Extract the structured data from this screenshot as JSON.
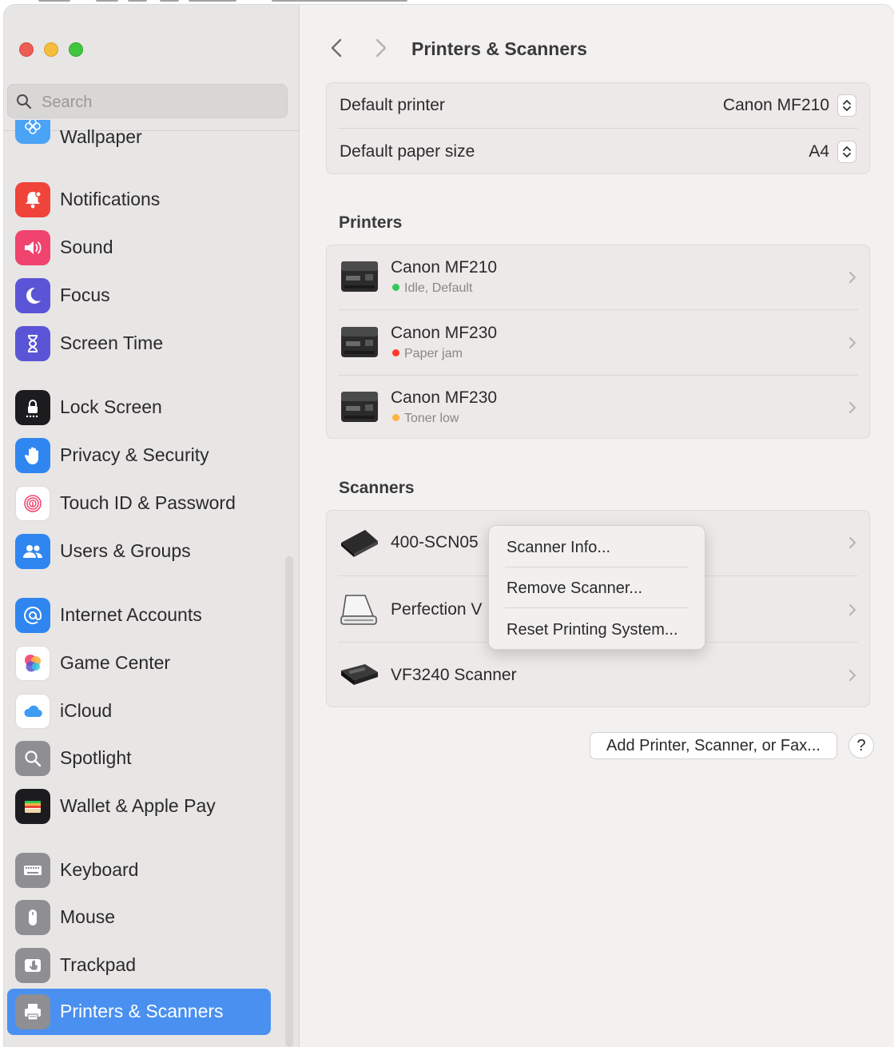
{
  "window": {
    "traffic_lights": [
      "close",
      "minimize",
      "zoom"
    ]
  },
  "sidebar": {
    "search_placeholder": "Search",
    "selected": "Printers & Scanners",
    "items": [
      {
        "label": "Wallpaper",
        "icon": "wallpaper-icon",
        "color": "#4aa3f5"
      },
      {
        "label": "Notifications",
        "icon": "bell-icon",
        "color": "#f0443a"
      },
      {
        "label": "Sound",
        "icon": "speaker-icon",
        "color": "#f0436e"
      },
      {
        "label": "Focus",
        "icon": "moon-icon",
        "color": "#5a55d6"
      },
      {
        "label": "Screen Time",
        "icon": "hourglass-icon",
        "color": "#5a55d6"
      },
      {
        "label": "Lock Screen",
        "icon": "lock-icon",
        "color": "#1c1c1e"
      },
      {
        "label": "Privacy & Security",
        "icon": "hand-icon",
        "color": "#2f86f0"
      },
      {
        "label": "Touch ID & Password",
        "icon": "fingerprint-icon",
        "color": "#ffffff"
      },
      {
        "label": "Users & Groups",
        "icon": "users-icon",
        "color": "#2f86f0"
      },
      {
        "label": "Internet Accounts",
        "icon": "at-icon",
        "color": "#2f86f0"
      },
      {
        "label": "Game Center",
        "icon": "game-center-icon",
        "color": "#ffffff"
      },
      {
        "label": "iCloud",
        "icon": "cloud-icon",
        "color": "#ffffff"
      },
      {
        "label": "Spotlight",
        "icon": "magnifier-icon",
        "color": "#8e8e93"
      },
      {
        "label": "Wallet & Apple Pay",
        "icon": "wallet-icon",
        "color": "#1c1c1e"
      },
      {
        "label": "Keyboard",
        "icon": "keyboard-icon",
        "color": "#8e8e93"
      },
      {
        "label": "Mouse",
        "icon": "mouse-icon",
        "color": "#8e8e93"
      },
      {
        "label": "Trackpad",
        "icon": "trackpad-icon",
        "color": "#8e8e93"
      },
      {
        "label": "Printers & Scanners",
        "icon": "printer-icon",
        "color": "#8e8e93"
      }
    ]
  },
  "header": {
    "back_icon": "chevron-left-icon",
    "forward_icon": "chevron-right-icon",
    "title": "Printers & Scanners"
  },
  "defaults": {
    "printer_label": "Default printer",
    "printer_value": "Canon MF210",
    "paper_label": "Default paper size",
    "paper_value": "A4"
  },
  "printers": {
    "title": "Printers",
    "items": [
      {
        "name": "Canon MF210",
        "status": "Idle, Default",
        "status_color": "#34c759"
      },
      {
        "name": "Canon MF230",
        "status": "Paper jam",
        "status_color": "#ff3b30"
      },
      {
        "name": "Canon MF230",
        "status": "Toner low",
        "status_color": "#ffb340"
      }
    ]
  },
  "scanners": {
    "title": "Scanners",
    "items": [
      {
        "name": "400-SCN05",
        "icon": "flat-scanner-icon"
      },
      {
        "name": "Perfection V",
        "icon": "flatbed-scanner-icon"
      },
      {
        "name": "VF3240 Scanner",
        "icon": "document-scanner-icon"
      }
    ]
  },
  "context_menu": {
    "items": [
      "Scanner Info...",
      "Remove Scanner...",
      "Reset Printing System..."
    ]
  },
  "footer": {
    "add_label": "Add Printer, Scanner, or Fax...",
    "help_label": "?"
  }
}
